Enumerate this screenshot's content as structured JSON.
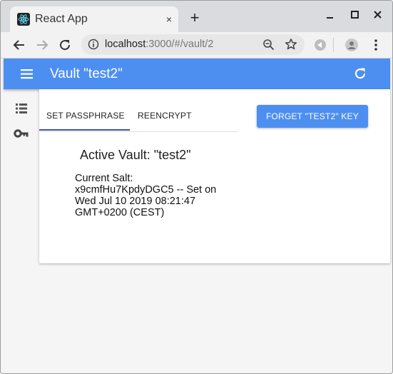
{
  "browser": {
    "tab_title": "React App",
    "tab_close_symbol": "×",
    "new_tab_symbol": "+",
    "url_host": "localhost",
    "url_rest": ":3000/#/vault/2"
  },
  "appbar": {
    "title": "Vault \"test2\"",
    "color": "#4d8ff1"
  },
  "sidebar": {
    "items": [
      {
        "icon": "list-icon"
      },
      {
        "icon": "key-icon"
      }
    ]
  },
  "card": {
    "tabs": [
      {
        "label": "SET PASSPHRASE",
        "selected": true
      },
      {
        "label": "REENCRYPT",
        "selected": false
      }
    ],
    "forget_button": "FORGET \"TEST2\" KEY",
    "heading": "Active Vault: \"test2\"",
    "salt_text": "Current Salt: x9cmfHu7KpdyDGC5 -- Set on Wed Jul 10 2019 08:21:47 GMT+0200 (CEST)"
  },
  "colors": {
    "accent": "#4d8ff1",
    "tab_indicator": "#3f51b5"
  }
}
